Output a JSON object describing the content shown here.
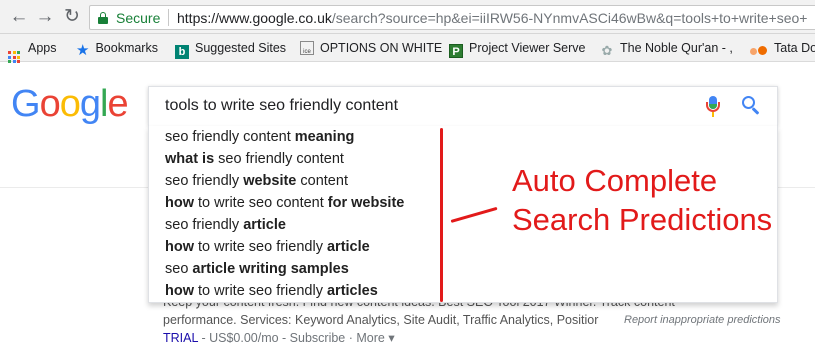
{
  "address_bar": {
    "secure_label": "Secure",
    "url_host": "https://www.google.co.uk",
    "url_rest": "/search?source=hp&ei=iiIRW56-NYnmvASCi46wBw&q=tools+to+write+seo+"
  },
  "bookmarks": [
    {
      "label": "Apps",
      "icon": "apps-grid-icon"
    },
    {
      "label": "Bookmarks",
      "icon": "star-icon"
    },
    {
      "label": "Suggested Sites",
      "icon": "bing-icon"
    },
    {
      "label": "OPTIONS ON WHITE",
      "icon": "options-icon"
    },
    {
      "label": "Project Viewer Serve",
      "icon": "project-viewer-icon"
    },
    {
      "label": "The Noble Qur'an - ,",
      "icon": "quran-icon"
    },
    {
      "label": "Tata Do",
      "icon": "tata-icon"
    }
  ],
  "google": {
    "logo": [
      "G",
      "o",
      "o",
      "g",
      "l",
      "e"
    ],
    "logo_colors": [
      "#4285f4",
      "#ea4335",
      "#fbbc05",
      "#4285f4",
      "#34a853",
      "#ea4335"
    ]
  },
  "search": {
    "query": "tools to write seo friendly content"
  },
  "suggestions": [
    {
      "parts": [
        {
          "t": "seo friendly content ",
          "b": false
        },
        {
          "t": "meaning",
          "b": true
        }
      ]
    },
    {
      "parts": [
        {
          "t": "what is",
          "b": true
        },
        {
          "t": " seo friendly content",
          "b": false
        }
      ]
    },
    {
      "parts": [
        {
          "t": "seo friendly ",
          "b": false
        },
        {
          "t": "website",
          "b": true
        },
        {
          "t": " content",
          "b": false
        }
      ]
    },
    {
      "parts": [
        {
          "t": "how",
          "b": true
        },
        {
          "t": " to write seo content ",
          "b": false
        },
        {
          "t": "for website",
          "b": true
        }
      ]
    },
    {
      "parts": [
        {
          "t": "seo friendly ",
          "b": false
        },
        {
          "t": "article",
          "b": true
        }
      ]
    },
    {
      "parts": [
        {
          "t": "how",
          "b": true
        },
        {
          "t": " to write seo friendly ",
          "b": false
        },
        {
          "t": "article",
          "b": true
        }
      ]
    },
    {
      "parts": [
        {
          "t": "seo ",
          "b": false
        },
        {
          "t": "article writing samples",
          "b": true
        }
      ]
    },
    {
      "parts": [
        {
          "t": "how",
          "b": true
        },
        {
          "t": " to write seo friendly ",
          "b": false
        },
        {
          "t": "articles",
          "b": true
        }
      ]
    }
  ],
  "result": {
    "line1": "Keep your content fresh. Find new content ideas. Best SEO Tool 2017 Winner. Track content",
    "line2": "performance. Services: Keyword Analytics, Site Audit, Traffic Analytics, Positior",
    "report": "Report inappropriate predictions",
    "trial": "TRIAL",
    "price": " - US$0.00/mo - Subscribe · More ▾"
  },
  "annotation": {
    "line1": "Auto Complete",
    "line2": "Search Predictions",
    "color": "#e21a1a"
  }
}
